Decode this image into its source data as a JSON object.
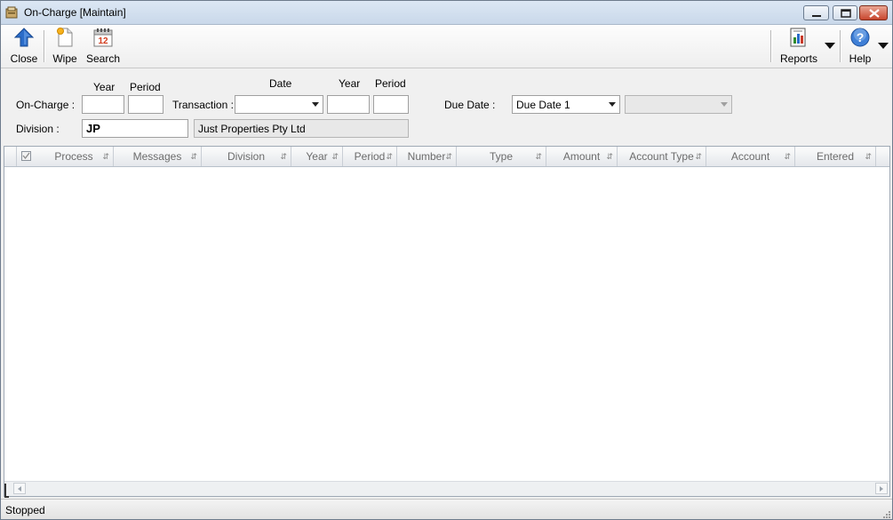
{
  "window": {
    "title": "On-Charge [Maintain]"
  },
  "toolbar": {
    "close_label": "Close",
    "wipe_label": "Wipe",
    "search_label": "Search",
    "search_icon_number": "12",
    "reports_label": "Reports",
    "help_label": "Help"
  },
  "form": {
    "on_charge_label": "On-Charge :",
    "year_header": "Year",
    "period_header": "Period",
    "transaction_label": "Transaction :",
    "date_header": "Date",
    "transaction_year_header": "Year",
    "transaction_period_header": "Period",
    "due_date_label": "Due Date :",
    "due_date_value": "Due Date 1",
    "division_label": "Division :",
    "division_code": "JP",
    "division_name": "Just Properties Pty Ltd"
  },
  "grid": {
    "columns": [
      "Process",
      "Messages",
      "Division",
      "Year",
      "Period",
      "Number",
      "Type",
      "Amount",
      "Account Type",
      "Account",
      "Entered"
    ]
  },
  "status": {
    "text": "Stopped"
  },
  "colors": {
    "accent": "#2a6cc9",
    "titlebar": "#c9d8ea",
    "close_button": "#c8462e"
  }
}
